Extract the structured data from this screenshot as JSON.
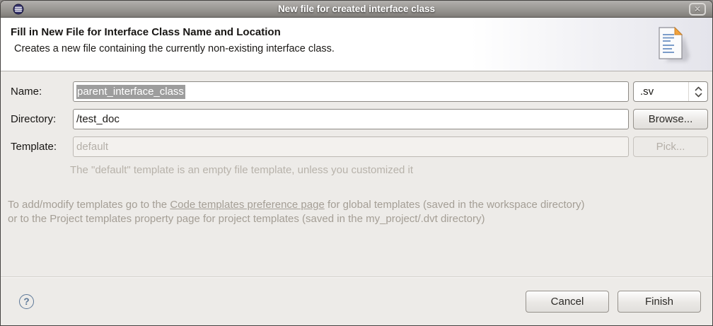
{
  "titlebar": {
    "title": "New file for created interface class",
    "close_glyph": "✕"
  },
  "header": {
    "title": "Fill in New File for Interface Class Name and Location",
    "subtitle": "Creates a new file containing the currently non-existing interface class."
  },
  "form": {
    "name_label": "Name:",
    "name_value": "parent_interface_class",
    "extension_value": ".sv",
    "directory_label": "Directory:",
    "directory_value": "/test_doc",
    "browse_label": "Browse...",
    "template_label": "Template:",
    "template_value": "default",
    "pick_label": "Pick...",
    "template_hint": "The \"default\" template is an empty file template, unless you customized it"
  },
  "notes": {
    "before_link": "To add/modify templates go to the ",
    "link_text": "Code templates preference page",
    "after_link": " for global templates (saved in the workspace directory)",
    "line2": "or to the Project templates property page for project templates (saved in the my_project/.dvt directory)"
  },
  "footer": {
    "help_glyph": "?",
    "cancel_label": "Cancel",
    "finish_label": "Finish"
  },
  "colors": {
    "selection_bg": "#9d9d9d",
    "help_accent": "#5d7898",
    "muted_text": "#a49e95",
    "titlebar_gray": "#918e8a"
  }
}
